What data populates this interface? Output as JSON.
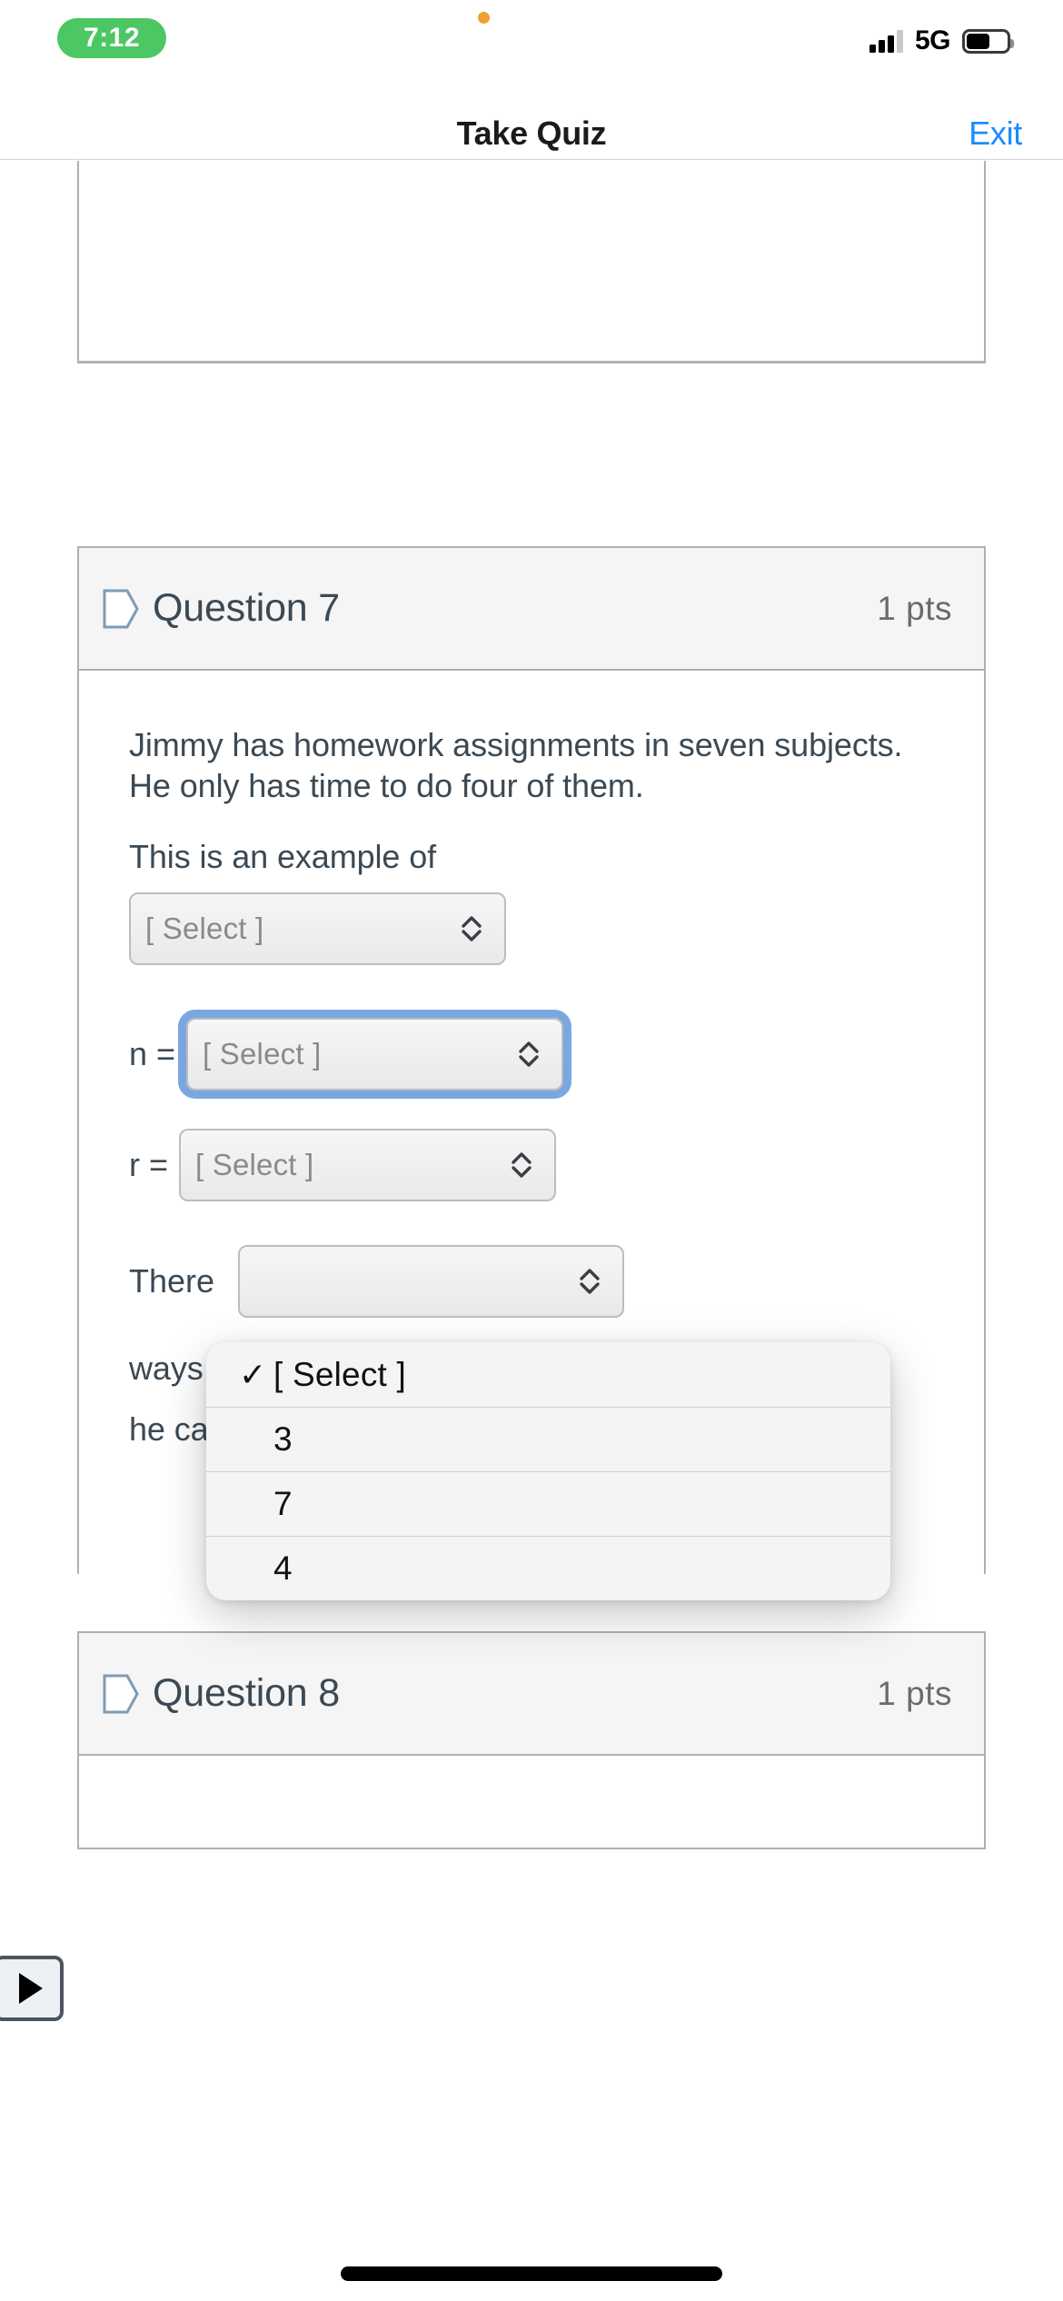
{
  "status_bar": {
    "time": "7:12",
    "network": "5G",
    "signal_icon": "cellular-signal-icon",
    "battery_icon": "battery-icon",
    "privacy_indicator_icon": "orange-privacy-dot-icon"
  },
  "nav": {
    "title": "Take Quiz",
    "exit_label": "Exit"
  },
  "questions": [
    {
      "id": "partial-top",
      "title": "",
      "points": ""
    },
    {
      "id": "q7",
      "title": "Question 7",
      "points": "1 pts",
      "flag_icon": "question-flag-icon",
      "body": {
        "paragraph_1": "Jimmy has homework assignments in seven subjects.  He only has time to do four of them.",
        "prompt_label": "This is an example of",
        "select_example": {
          "value": "[ Select ]",
          "chevron_icon": "chevron-up-down-icon"
        },
        "n_label": "n =",
        "select_n": {
          "value": "[ Select ]",
          "chevron_icon": "chevron-up-down-icon",
          "focused": true
        },
        "r_label": "r =",
        "select_r": {
          "value": "[ Select ]",
          "chevron_icon": "chevron-up-down-icon"
        },
        "there_are_text": "There",
        "ways_text": "ways",
        "select_answer": {
          "value": "",
          "chevron_icon": "chevron-up-down-icon"
        },
        "closing_text": "he can complete."
      }
    },
    {
      "id": "q8",
      "title": "Question 8",
      "points": "1 pts",
      "flag_icon": "question-flag-icon"
    }
  ],
  "dropdown": {
    "open": true,
    "options": [
      {
        "label": "[ Select ]",
        "selected": true
      },
      {
        "label": "3",
        "selected": false
      },
      {
        "label": "7",
        "selected": false
      },
      {
        "label": "4",
        "selected": false
      }
    ],
    "check_glyph": "✓"
  },
  "overlay": {
    "play_button_icon": "play-icon"
  },
  "colors": {
    "accent_link": "#1a8cff",
    "time_pill_bg": "#4cc764",
    "focus_ring": "#7aa7e0",
    "text_primary": "#3b4954",
    "card_border": "#b0b0b0",
    "header_bg": "#f5f5f5"
  }
}
